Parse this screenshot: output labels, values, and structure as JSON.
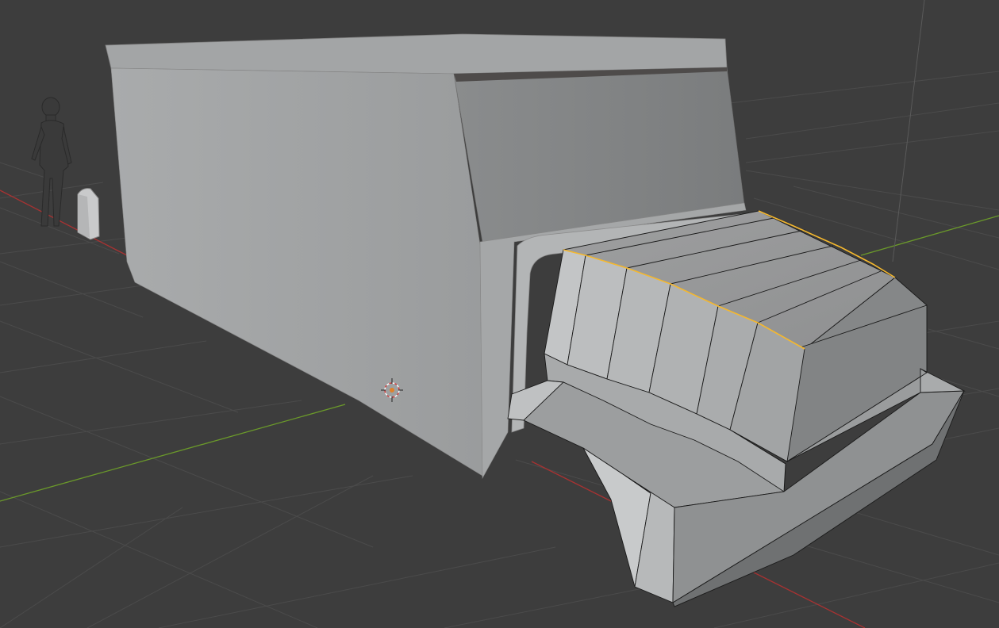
{
  "app": {
    "name": "3D Viewport",
    "background_color": "#3d3d3d"
  },
  "scene": {
    "grid_color": "#4b4b4b",
    "x_axis_color": "#a83232",
    "y_axis_color": "#6b9a2a",
    "z_axis_color": "#5a5a5a",
    "selection_edge_color": "#f5b82e",
    "mesh_base_color": "#9a9c9d",
    "objects": [
      {
        "name": "human-reference",
        "icon": "person-figure"
      },
      {
        "name": "truck-box-body"
      },
      {
        "name": "truck-hood-cab",
        "edit_mode": true
      },
      {
        "name": "tombstone-reference"
      }
    ],
    "cursor_icon": "3d-cursor-icon"
  }
}
